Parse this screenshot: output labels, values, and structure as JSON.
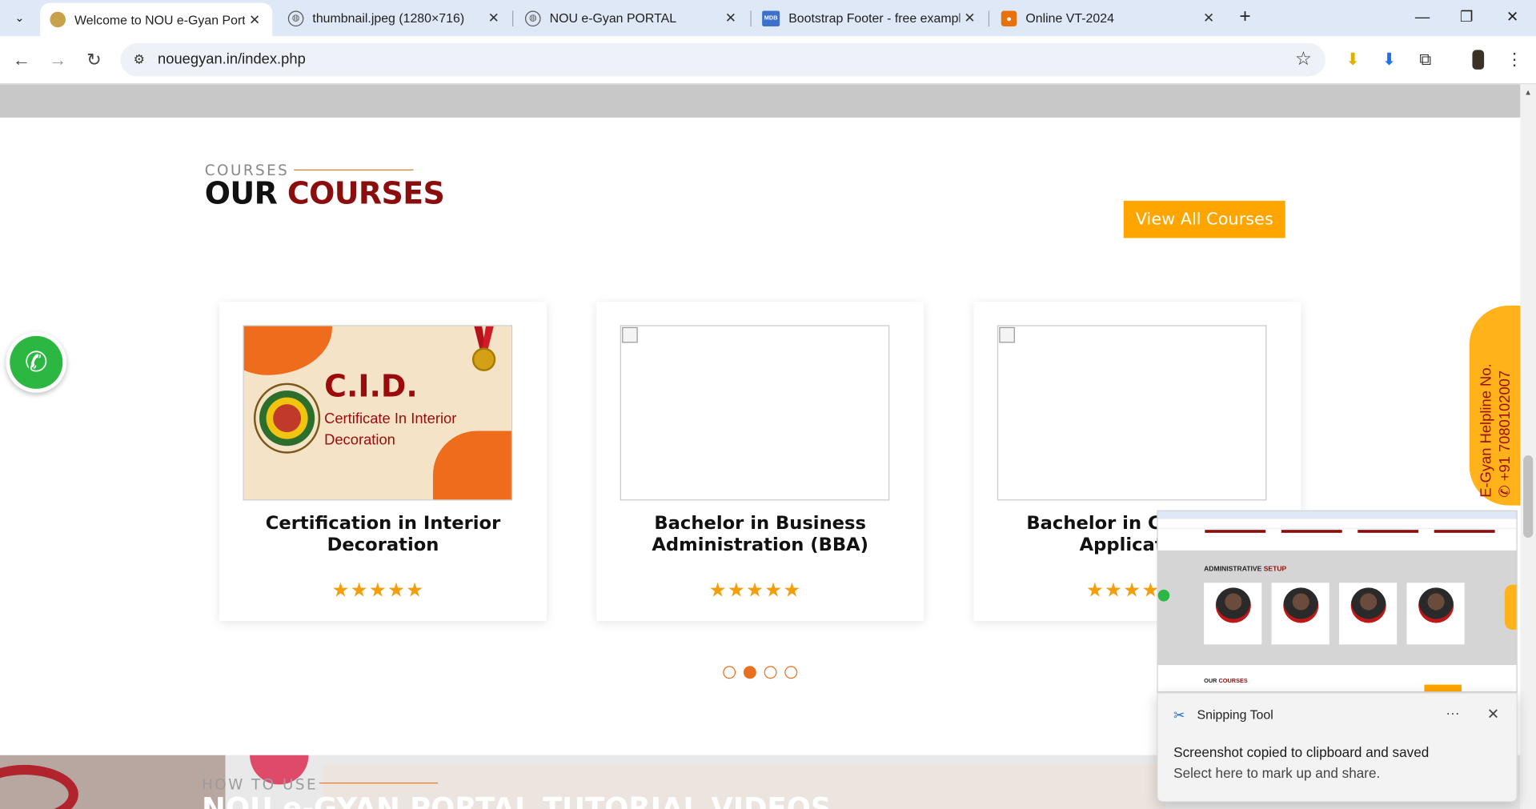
{
  "browser": {
    "tabs": [
      {
        "title": "Welcome to NOU e-Gyan Portal",
        "active": true
      },
      {
        "title": "thumbnail.jpeg (1280×716)",
        "active": false
      },
      {
        "title": "NOU e-Gyan PORTAL",
        "active": false
      },
      {
        "title": "Bootstrap Footer - free example",
        "active": false
      },
      {
        "title": "Online VT-2024",
        "active": false
      }
    ],
    "url": "nouegyan.in/index.php",
    "icons": {
      "tab_menu": "chevron-down-icon",
      "new_tab": "plus-icon",
      "back": "arrow-left-icon",
      "forward": "arrow-right-icon",
      "reload": "reload-icon",
      "site_info": "tune-icon",
      "bookmark": "star-outline-icon",
      "download_ext": "download-arrow-icon",
      "downloads": "download-icon",
      "extensions": "puzzle-icon",
      "profile": "avatar"
    }
  },
  "section": {
    "eyebrow": "COURSES",
    "title_main": "OUR",
    "title_accent": "COURSES",
    "view_all_label": "View All Courses",
    "accent_color": "#8b0e0e",
    "button_color": "#ffa500"
  },
  "courses": [
    {
      "title": "Certification in Interior Decoration",
      "image_heading": "C.I.D.",
      "image_subheading": "Certificate In Interior Decoration",
      "stars": "★★★★★"
    },
    {
      "title": "Bachelor in Business Administration (BBA)",
      "stars": "★★★★★"
    },
    {
      "title": "Bachelor in Computer Application",
      "stars": "★★★★★"
    }
  ],
  "carousel": {
    "pages": 4,
    "active_index": 1
  },
  "helpline": {
    "label": "E-Gyan Helpline No.",
    "phone": "+91 7080102007"
  },
  "next_section": {
    "eyebrow": "HOW TO USE",
    "title": "NOU e-GYAN PORTAL TUTORIAL VIDEOS"
  },
  "snip_preview": {
    "admin_main": "ADMINISTRATIVE",
    "admin_accent": "SETUP",
    "courses_main": "OUR",
    "courses_accent": "COURSES"
  },
  "toast": {
    "app": "Snipping Tool",
    "message": "Screenshot copied to clipboard and saved",
    "sub": "Select here to mark up and share."
  }
}
